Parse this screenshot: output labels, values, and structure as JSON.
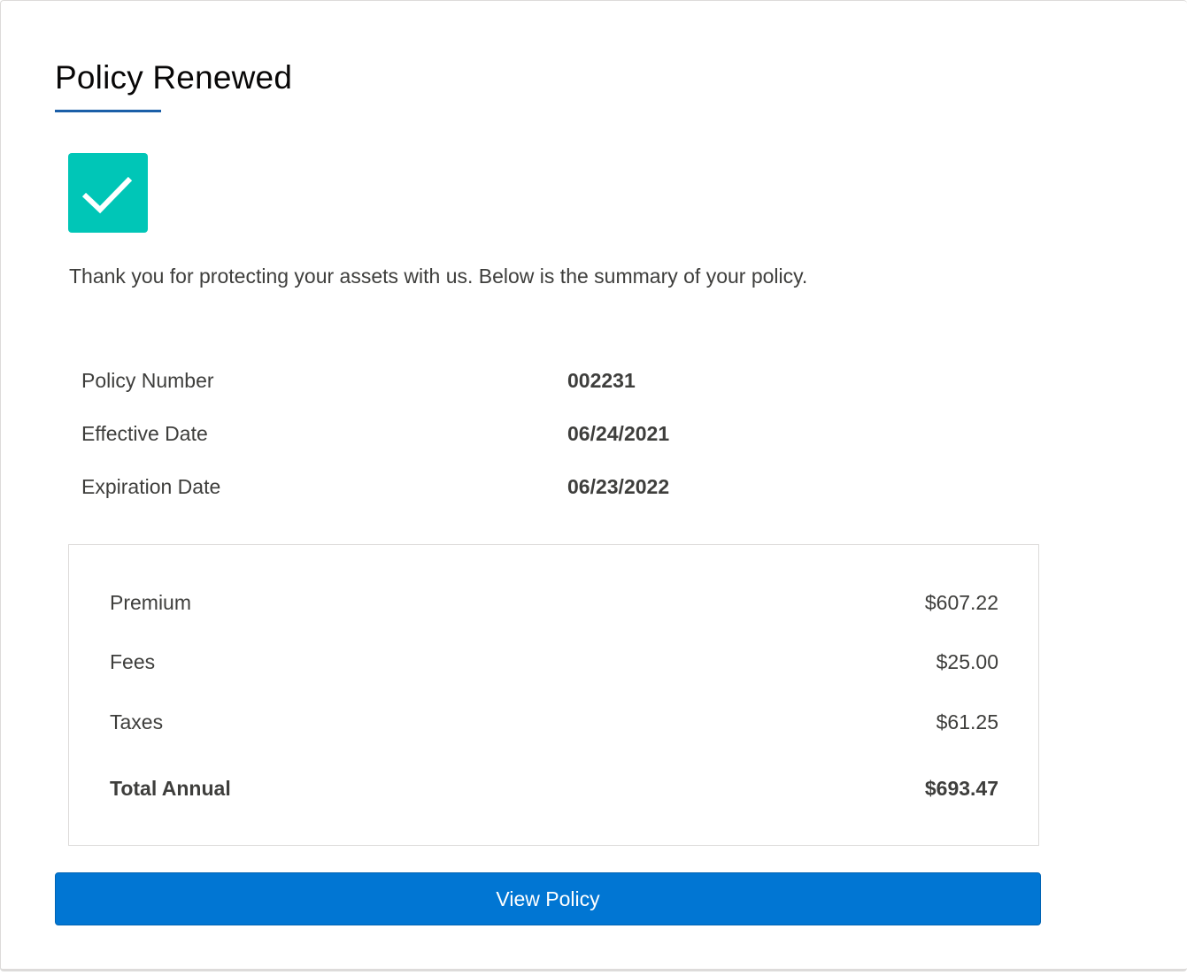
{
  "header": {
    "title": "Policy Renewed"
  },
  "status": {
    "icon": "checkmark-icon",
    "color": "#00c6b7"
  },
  "message": "Thank you for protecting your assets with us. Below is the summary of your policy.",
  "details": [
    {
      "label": "Policy Number",
      "value": "002231"
    },
    {
      "label": "Effective Date",
      "value": "06/24/2021"
    },
    {
      "label": "Expiration Date",
      "value": "06/23/2022"
    }
  ],
  "summary": {
    "rows": [
      {
        "label": "Premium",
        "value": "$607.22"
      },
      {
        "label": "Fees",
        "value": "$25.00"
      },
      {
        "label": "Taxes",
        "value": "$61.25"
      }
    ],
    "total": {
      "label": "Total Annual",
      "value": "$693.47"
    }
  },
  "actions": {
    "view_policy_label": "View Policy",
    "button_color": "#0176d3",
    "accent_color": "#1b5fa8"
  }
}
